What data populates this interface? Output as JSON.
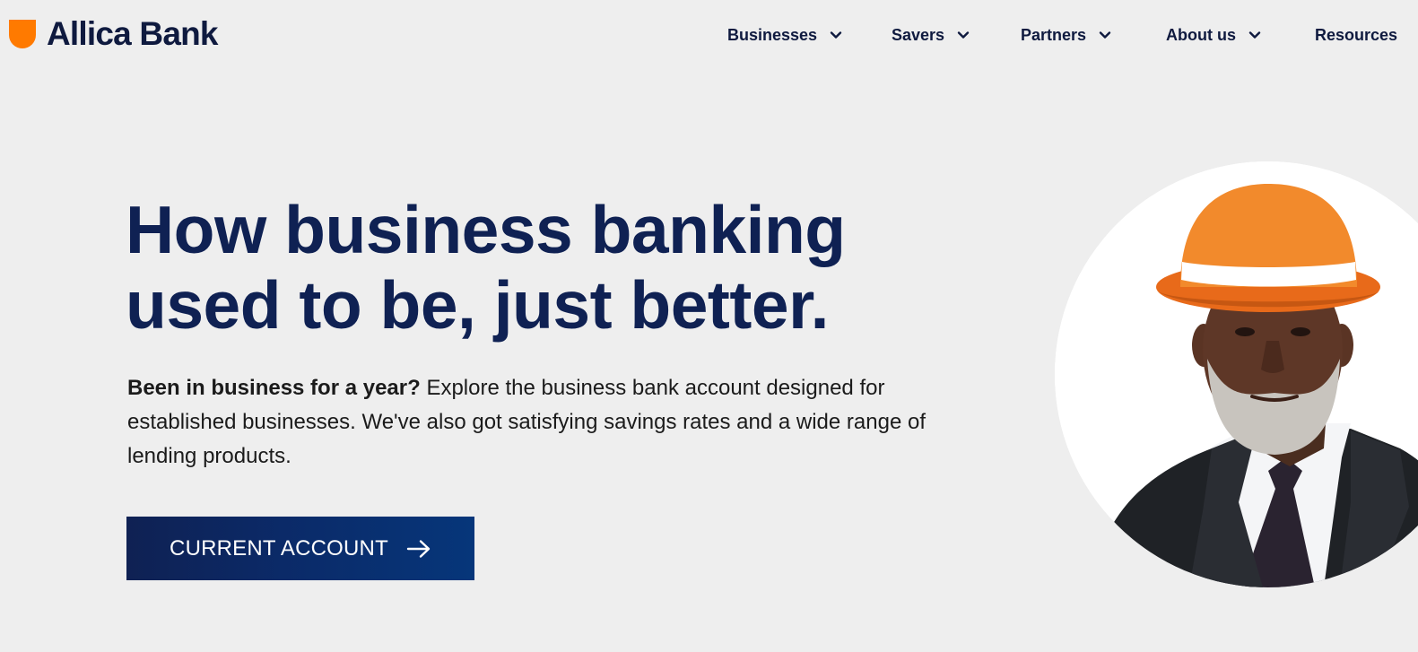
{
  "brand": {
    "name": "Allica Bank",
    "accent_color": "#ff7a00",
    "navy_color": "#0f2153",
    "logo_icon": "shield-logo-icon"
  },
  "nav": {
    "items": [
      {
        "label": "Businesses",
        "icon": "chevron-down-icon"
      },
      {
        "label": "Savers",
        "icon": "chevron-down-icon"
      },
      {
        "label": "Partners",
        "icon": "chevron-down-icon"
      },
      {
        "label": "About us",
        "icon": "chevron-down-icon"
      },
      {
        "label": "Resources"
      }
    ]
  },
  "hero": {
    "title_line1": "How business banking",
    "title_line2": "used to be, just better.",
    "body_bold": "Been in business for a year?",
    "body_text": " Explore the business bank account designed for established businesses. We've also got satisfying savings rates and a wide range of lending products.",
    "cta_label": "CURRENT ACCOUNT",
    "cta_icon": "arrow-right-icon",
    "image": "man-in-orange-bowler-hat-portrait"
  }
}
